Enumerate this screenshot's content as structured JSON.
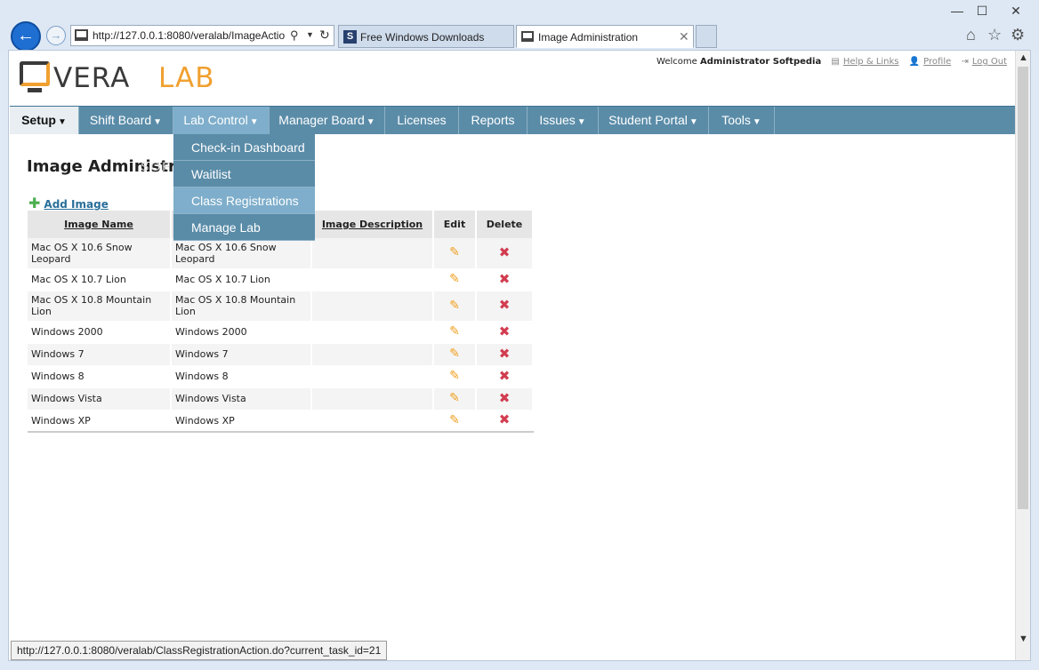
{
  "browser": {
    "address": "http://127.0.0.1:8080/veralab/ImageActio",
    "tabs": [
      {
        "label": "Free Windows Downloads"
      },
      {
        "label": "Image Administration"
      }
    ],
    "window_controls": {
      "minimize": "—",
      "maximize": "☐",
      "close": "✕"
    },
    "status_url": "http://127.0.0.1:8080/veralab/ClassRegistrationAction.do?current_task_id=21"
  },
  "logo": {
    "part1": "VERA",
    "part2": "LAB"
  },
  "userbar": {
    "welcome": "Welcome",
    "user": "Administrator Softpedia",
    "help": "Help & Links",
    "profile": "Profile",
    "logout": "Log Out"
  },
  "nav": {
    "items": [
      {
        "label": "Setup"
      },
      {
        "label": "Shift Board"
      },
      {
        "label": "Lab Control"
      },
      {
        "label": "Manager Board"
      },
      {
        "label": "Licenses"
      },
      {
        "label": "Reports"
      },
      {
        "label": "Issues"
      },
      {
        "label": "Student Portal"
      },
      {
        "label": "Tools"
      }
    ],
    "dropdown": [
      {
        "label": "Check-in Dashboard"
      },
      {
        "label": "Waitlist"
      },
      {
        "label": "Class Registrations"
      },
      {
        "label": "Manage Lab"
      }
    ]
  },
  "page": {
    "title": "Image Administra",
    "watermark": "SOFTPEDIA",
    "add_image": "Add Image"
  },
  "table": {
    "headers": {
      "name": "Image Name",
      "description": "Image Description",
      "edit": "Edit",
      "delete": "Delete"
    },
    "rows": [
      {
        "name": "Mac OS X 10.6 Snow Leopard",
        "label": "Mac OS X 10.6 Snow Leopard",
        "description": ""
      },
      {
        "name": "Mac OS X 10.7 Lion",
        "label": "Mac OS X 10.7 Lion",
        "description": ""
      },
      {
        "name": "Mac OS X 10.8 Mountain Lion",
        "label": "Mac OS X 10.8 Mountain Lion",
        "description": ""
      },
      {
        "name": "Windows 2000",
        "label": "Windows 2000",
        "description": ""
      },
      {
        "name": "Windows 7",
        "label": "Windows 7",
        "description": ""
      },
      {
        "name": "Windows 8",
        "label": "Windows 8",
        "description": ""
      },
      {
        "name": "Windows Vista",
        "label": "Windows Vista",
        "description": ""
      },
      {
        "name": "Windows XP",
        "label": "Windows XP",
        "description": ""
      }
    ]
  },
  "colors": {
    "nav": "#5a8ca8",
    "nav_open": "#7eaecb",
    "accent": "#f0a030",
    "delete": "#d23c50"
  }
}
